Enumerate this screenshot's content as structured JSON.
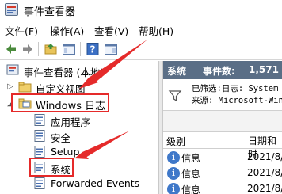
{
  "window": {
    "title": "事件查看器"
  },
  "menu": [
    {
      "label": "文件(F)"
    },
    {
      "label": "操作(A)"
    },
    {
      "label": "查看(V)"
    },
    {
      "label": "帮助(H)"
    }
  ],
  "tree": {
    "root": "事件查看器 (本地)",
    "custom_views": "自定义视图",
    "windows_logs": "Windows 日志",
    "children": [
      "应用程序",
      "安全",
      "Setup",
      "系统",
      "Forwarded Events"
    ]
  },
  "panel": {
    "name": "系统",
    "event_count_label": "事件数:",
    "event_count": "1,571",
    "filter_line1": "已筛选:日志: System",
    "filter_line2": "来源: Microsoft-Windows",
    "col_level": "级别",
    "col_date": "日期和时",
    "rows": [
      {
        "level": "信息",
        "date": "2021/8/"
      },
      {
        "level": "信息",
        "date": "2021/8/"
      },
      {
        "level": "信息",
        "date": "2021/8/"
      }
    ]
  },
  "colors": {
    "header_bg": "#5a6e86",
    "highlight": "#e52a2a",
    "info_icon": "#3f78c9"
  }
}
